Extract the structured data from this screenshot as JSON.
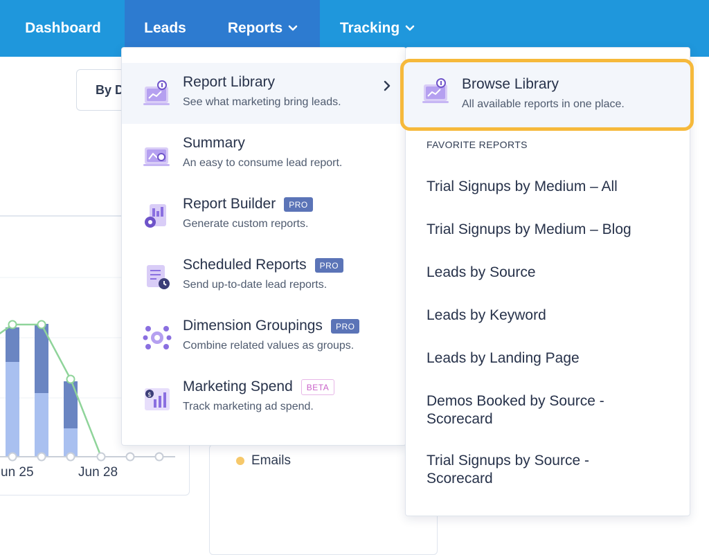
{
  "nav": {
    "dashboard": "Dashboard",
    "leads": "Leads",
    "reports": "Reports",
    "tracking": "Tracking"
  },
  "background": {
    "filter_button": "By D",
    "x_ticks": [
      "un 25",
      "Jun 28"
    ],
    "legend": {
      "label": "Emails",
      "color": "#f6c86a"
    }
  },
  "colors": {
    "nav_bg": "#1f97dc",
    "nav_active": "#2d7bd0",
    "highlight": "#f6b93b",
    "pro_badge": "#5b74b7",
    "beta_badge": "#c962c9"
  },
  "menu": {
    "items": [
      {
        "title": "Report Library",
        "desc": "See what marketing bring leads.",
        "icon": "report-library-icon",
        "badge": ""
      },
      {
        "title": "Summary",
        "desc": "An easy to consume lead report.",
        "icon": "summary-icon",
        "badge": ""
      },
      {
        "title": "Report Builder",
        "desc": "Generate custom reports.",
        "icon": "report-builder-icon",
        "badge": "PRO"
      },
      {
        "title": "Scheduled Reports",
        "desc": "Send up-to-date lead reports.",
        "icon": "scheduled-reports-icon",
        "badge": "PRO"
      },
      {
        "title": "Dimension Groupings",
        "desc": "Combine related values as groups.",
        "icon": "dimension-groupings-icon",
        "badge": "PRO"
      },
      {
        "title": "Marketing Spend",
        "desc": "Track marketing ad spend.",
        "icon": "marketing-spend-icon",
        "badge": "BETA"
      }
    ]
  },
  "submenu": {
    "browse": {
      "title": "Browse Library",
      "desc": "All available reports in one place."
    },
    "favorites_heading": "FAVORITE REPORTS",
    "favorites": [
      "Trial Signups by Medium – All",
      "Trial Signups by Medium – Blog",
      "Leads by Source",
      "Leads by Keyword",
      "Leads by Landing Page",
      "Demos Booked by Source - Scorecard",
      "Trial Signups by Source - Scorecard"
    ]
  }
}
